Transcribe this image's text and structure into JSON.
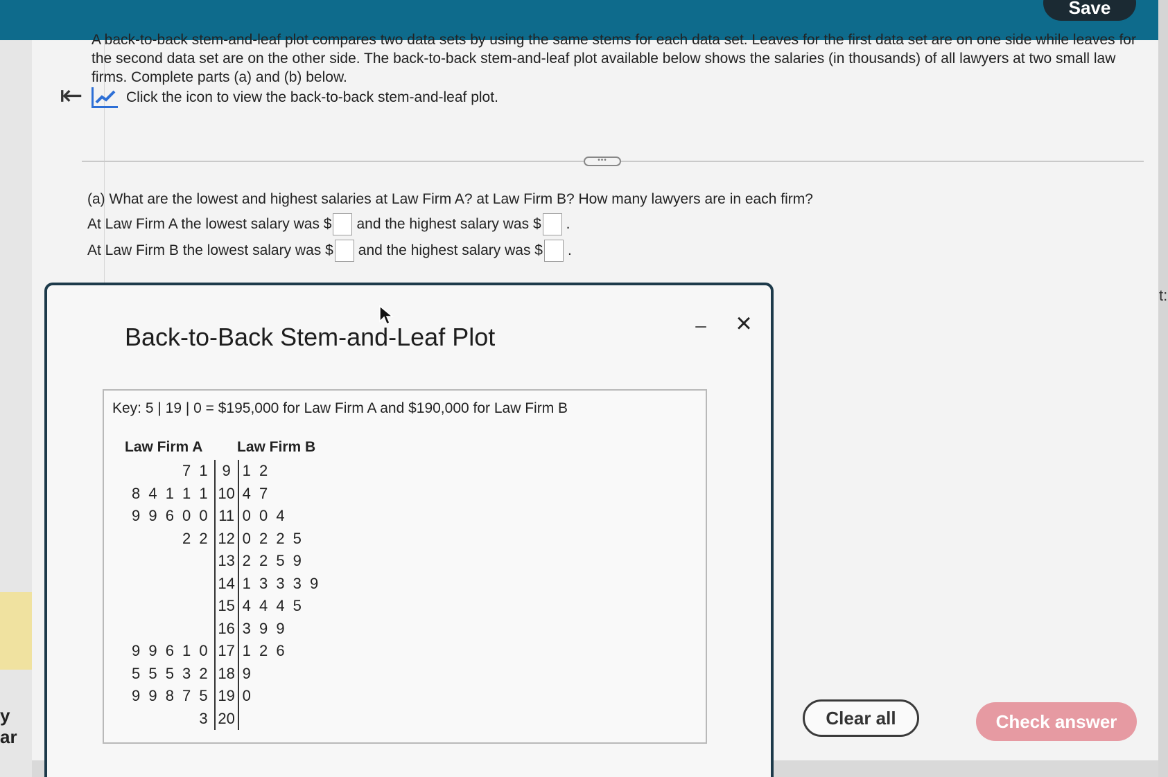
{
  "topbar": {
    "save_label": "Save"
  },
  "left": {
    "fragment": "y ar"
  },
  "right": {
    "fragment": "t:"
  },
  "intro": {
    "text": "A back-to-back stem-and-leaf plot compares two data sets by using the same stems for each data set. Leaves for the first data set are on one side while leaves for the second data set are on the other side. The back-to-back stem-and-leaf plot available below shows the salaries (in thousands) of all lawyers at two small law firms. Complete parts (a) and (b) below.",
    "icon_line": "Click the icon to view the back-to-back stem-and-leaf plot."
  },
  "question_a": "(a) What are the lowest and highest salaries at Law Firm A? at Law Firm B? How many lawyers are in each firm?",
  "answers": {
    "firm_a_prefix": "At Law Firm A the lowest salary was $",
    "firm_b_prefix": "At Law Firm B the lowest salary was $",
    "mid": "and the highest salary was $",
    "end": "."
  },
  "modal": {
    "title": "Back-to-Back Stem-and-Leaf Plot",
    "minimize": "–",
    "close": "×",
    "key": "Key: 5 | 19 | 0 = $195,000 for Law Firm A and $190,000 for Law Firm B",
    "head_a": "Law Firm A",
    "head_b": "Law Firm B",
    "rows": [
      {
        "a": "7 1",
        "stem": "9",
        "b": "1 2"
      },
      {
        "a": "8 4 1 1 1",
        "stem": "10",
        "b": "4 7"
      },
      {
        "a": "9 9 6 0 0",
        "stem": "11",
        "b": "0 0 4"
      },
      {
        "a": "2 2",
        "stem": "12",
        "b": "0 2 2 5"
      },
      {
        "a": "",
        "stem": "13",
        "b": "2 2 5 9"
      },
      {
        "a": "",
        "stem": "14",
        "b": "1 3 3 3 9"
      },
      {
        "a": "",
        "stem": "15",
        "b": "4 4 4 5"
      },
      {
        "a": "",
        "stem": "16",
        "b": "3 9 9"
      },
      {
        "a": "9 9 6 1 0",
        "stem": "17",
        "b": "1 2 6"
      },
      {
        "a": "5 5 5 3 2",
        "stem": "18",
        "b": "9"
      },
      {
        "a": "9 9 8 7 5",
        "stem": "19",
        "b": "0"
      },
      {
        "a": "3",
        "stem": "20",
        "b": ""
      }
    ]
  },
  "buttons": {
    "clear": "Clear all",
    "check": "Check answer"
  },
  "colors": {
    "topbar": "#0e6b8c",
    "check": "#e69aa2",
    "icon": "#2d6fd6"
  },
  "icons": [
    "collapse-left-icon",
    "chart-icon",
    "close-icon",
    "minimize-icon",
    "cursor-icon"
  ]
}
